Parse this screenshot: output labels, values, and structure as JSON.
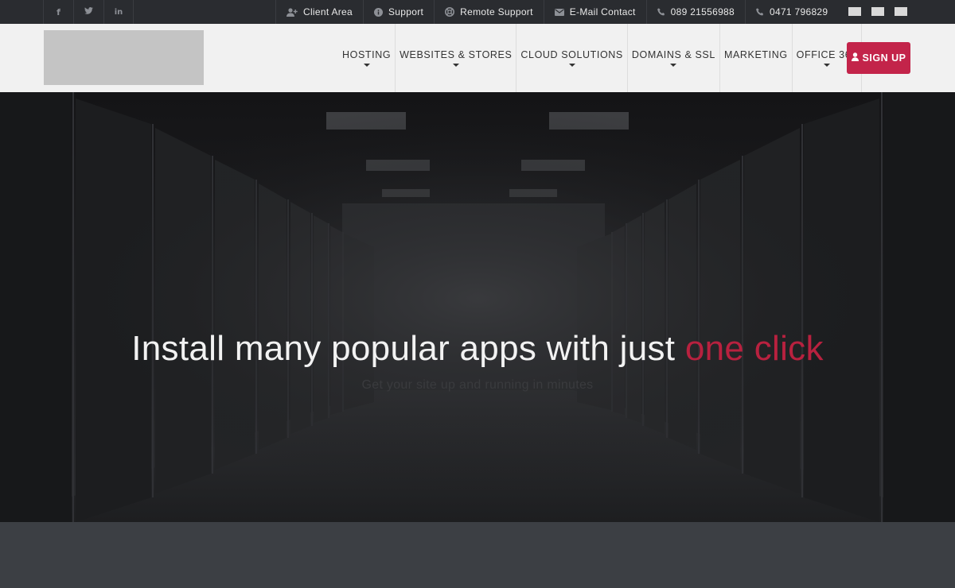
{
  "topbar": {
    "social": [
      {
        "icon": "facebook-icon",
        "glyph": "f"
      },
      {
        "icon": "twitter-icon",
        "glyph": "🐦"
      },
      {
        "icon": "linkedin-icon",
        "glyph": "in"
      }
    ],
    "links": [
      {
        "icon": "user-plus-icon",
        "label": "Client Area"
      },
      {
        "icon": "info-icon",
        "label": "Support"
      },
      {
        "icon": "lifebuoy-icon",
        "label": "Remote Support"
      },
      {
        "icon": "envelope-icon",
        "label": "E-Mail Contact"
      },
      {
        "icon": "phone-icon",
        "label": "089 21556988"
      },
      {
        "icon": "phone-icon",
        "label": "0471 796829"
      }
    ],
    "flags": [
      "flag-icon",
      "flag-icon",
      "flag-icon"
    ]
  },
  "nav": {
    "items": [
      {
        "label": "HOSTING",
        "dropdown": true
      },
      {
        "label": "WEBSITES & STORES",
        "dropdown": true
      },
      {
        "label": "CLOUD SOLUTIONS",
        "dropdown": true
      },
      {
        "label": "DOMAINS & SSL",
        "dropdown": true
      },
      {
        "label": "MARKETING",
        "dropdown": false
      },
      {
        "label": "OFFICE 365",
        "dropdown": true
      }
    ],
    "signup_label": "SIGN UP"
  },
  "hero": {
    "headline_main": "Install many popular apps with just",
    "headline_accent": "one click",
    "subline": "Get your site up and running in minutes"
  },
  "colors": {
    "accent": "#c3244a",
    "topbar_bg": "#2a2c30",
    "header_bg": "#f1f1f1",
    "band_bg": "#3c3f44"
  }
}
